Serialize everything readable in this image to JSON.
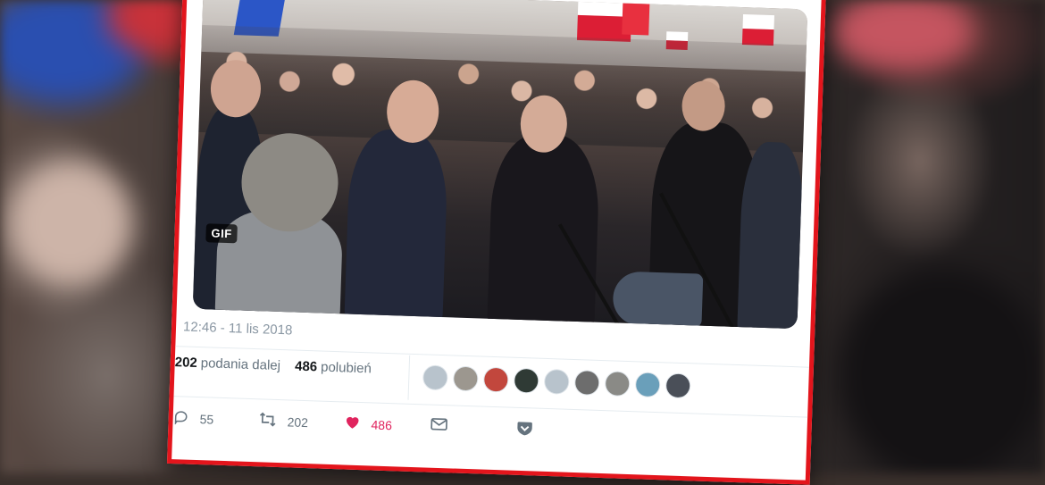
{
  "media": {
    "badge": "GIF"
  },
  "tweet": {
    "timestamp": "12:46 - 11 lis 2018",
    "retweets": {
      "count": "202",
      "label": "podania dalej"
    },
    "likes": {
      "count": "486",
      "label": "polubień"
    }
  },
  "avatars": [
    {
      "name": "default-avatar",
      "color": "#b8c3cc"
    },
    {
      "name": "coin-avatar",
      "color": "#9c978f"
    },
    {
      "name": "red-avatar",
      "color": "#c2473d"
    },
    {
      "name": "dark-avatar",
      "color": "#2f3a35"
    },
    {
      "name": "default-avatar",
      "color": "#b8c3cc"
    },
    {
      "name": "bw-avatar",
      "color": "#6d6d6d"
    },
    {
      "name": "sketch-avatar",
      "color": "#8a8a86"
    },
    {
      "name": "landscape-avatar",
      "color": "#6a9fba"
    },
    {
      "name": "photo-avatar",
      "color": "#4a4f58"
    }
  ],
  "actions": {
    "reply": {
      "icon": "reply-icon",
      "count": "55"
    },
    "retweet": {
      "icon": "retweet-icon",
      "count": "202"
    },
    "like": {
      "icon": "heart-icon",
      "count": "486",
      "color": "#e0245e"
    },
    "dm": {
      "icon": "mail-icon"
    },
    "more": {
      "icon": "chevron-down-icon"
    }
  },
  "colors": {
    "card_border": "#e3151c",
    "muted_text": "#65737e",
    "timestamp": "#8a97a3"
  }
}
